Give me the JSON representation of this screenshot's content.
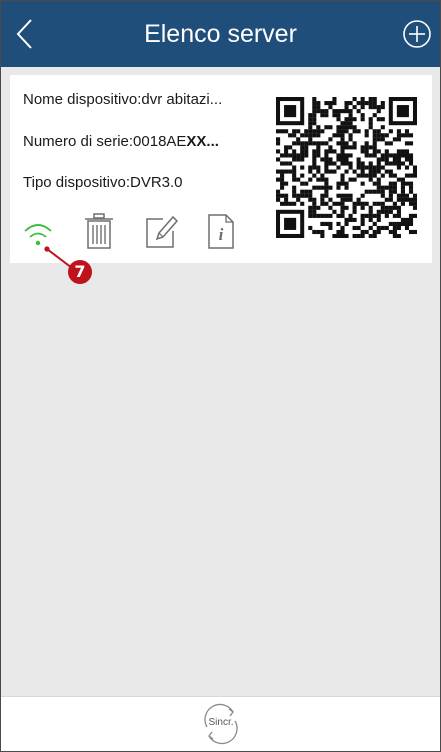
{
  "header": {
    "title": "Elenco server",
    "back_icon": "chevron-left-icon",
    "add_icon": "plus-circle-icon"
  },
  "device": {
    "name_line": "Nome dispositivo:dvr abitazi...",
    "serial_prefix": "Numero di serie:0018AE",
    "serial_masked": "XX...",
    "type_line": "Tipo dispositivo:DVR3.0",
    "actions": [
      "wifi-icon",
      "trash-icon",
      "edit-icon",
      "info-icon"
    ]
  },
  "annotation": {
    "number": "7",
    "color": "#c0121b"
  },
  "footer": {
    "sync_label": "Sincr."
  },
  "colors": {
    "header_bg": "#1f4e7a",
    "wifi_green": "#3bbf3b",
    "icon_gray": "#6e6e6e",
    "page_bg": "#e9e9ea"
  }
}
